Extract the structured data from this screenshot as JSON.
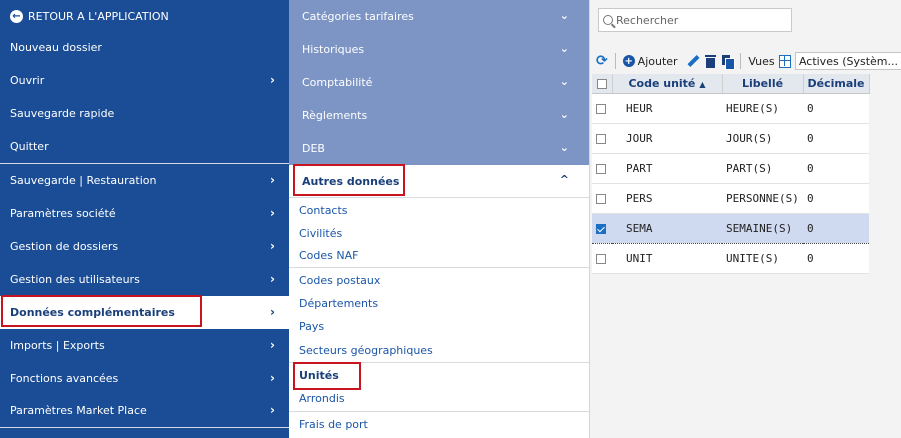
{
  "left_menu": {
    "items": [
      {
        "label": "RETOUR A L'APPLICATION",
        "chev": ""
      },
      {
        "label": "Nouveau dossier",
        "chev": ""
      },
      {
        "label": "Ouvrir",
        "chev": "›"
      },
      {
        "label": "Sauvegarde rapide",
        "chev": ""
      },
      {
        "label": "Quitter",
        "chev": ""
      },
      {
        "label": "Sauvegarde | Restauration",
        "chev": "›"
      },
      {
        "label": "Paramètres société",
        "chev": "›"
      },
      {
        "label": "Gestion de dossiers",
        "chev": "›"
      },
      {
        "label": "Gestion des utilisateurs",
        "chev": "›"
      },
      {
        "label": "Données complémentaires",
        "chev": "›"
      },
      {
        "label": "Imports | Exports",
        "chev": "›"
      },
      {
        "label": "Fonctions avancées",
        "chev": "›"
      },
      {
        "label": "Paramètres Market Place",
        "chev": "›"
      }
    ]
  },
  "mid_menu": {
    "collapsed": [
      {
        "label": "Catégories tarifaires",
        "chev": "⌄"
      },
      {
        "label": "Historiques",
        "chev": "⌄"
      },
      {
        "label": "Comptabilité",
        "chev": "⌄"
      },
      {
        "label": "Règlements",
        "chev": "⌄"
      },
      {
        "label": "DEB",
        "chev": "⌄"
      }
    ],
    "open_header": {
      "label": "Autres données",
      "chev": "^"
    },
    "items": [
      {
        "label": "Contacts"
      },
      {
        "label": "Civilités"
      },
      {
        "label": "Codes NAF"
      },
      {
        "label": "Codes postaux"
      },
      {
        "label": "Départements"
      },
      {
        "label": "Pays"
      },
      {
        "label": "Secteurs géographiques"
      },
      {
        "label": "Unités"
      },
      {
        "label": "Arrondis"
      },
      {
        "label": "Frais de port"
      }
    ]
  },
  "right_panel": {
    "search_placeholder": "Rechercher",
    "toolbar": {
      "add_label": "Ajouter",
      "vues_label": "Vues",
      "vues_value": "Actives (Systèm..."
    },
    "columns": [
      "Code unité",
      "Libellé",
      "Décimale"
    ],
    "rows": [
      {
        "code": "HEUR",
        "libelle": "HEURE(S)",
        "decimale": "0",
        "checked": false
      },
      {
        "code": "JOUR",
        "libelle": "JOUR(S)",
        "decimale": "0",
        "checked": false
      },
      {
        "code": "PART",
        "libelle": "PART(S)",
        "decimale": "0",
        "checked": false
      },
      {
        "code": "PERS",
        "libelle": "PERSONNE(S)",
        "decimale": "0",
        "checked": false
      },
      {
        "code": "SEMA",
        "libelle": "SEMAINE(S)",
        "decimale": "0",
        "checked": true
      },
      {
        "code": "UNIT",
        "libelle": "UNITE(S)",
        "decimale": "0",
        "checked": false
      }
    ]
  }
}
